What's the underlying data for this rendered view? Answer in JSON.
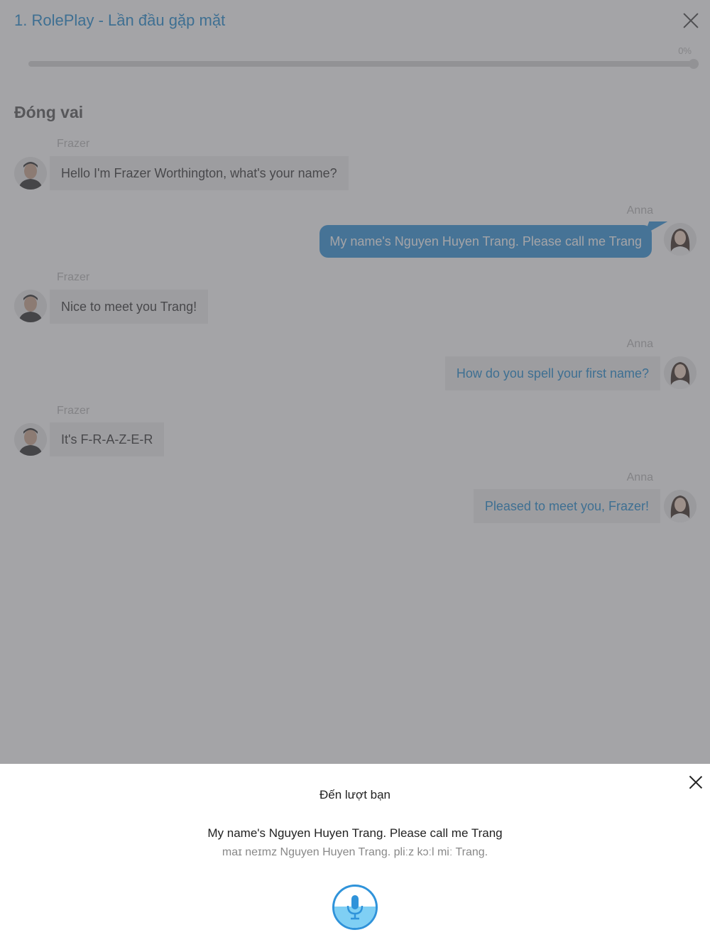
{
  "header": {
    "title": "1. RolePlay - Lần đầu gặp mặt",
    "close_icon": "close-icon",
    "progress_label": "0%",
    "progress_fraction": 0
  },
  "section_title": "Đóng vai",
  "messages": [
    {
      "speaker": "Frazer",
      "text": "Hello I'm Frazer Worthington, what's your name?",
      "side": "left"
    },
    {
      "speaker": "Anna",
      "text": "My name's Nguyen Huyen Trang. Please call me Trang",
      "side": "right",
      "active": true
    },
    {
      "speaker": "Frazer",
      "text": "Nice to meet you Trang!",
      "side": "left"
    },
    {
      "speaker": "Anna",
      "text": "How do you spell your first name?",
      "side": "right"
    },
    {
      "speaker": "Frazer",
      "text": "It's F-R-A-Z-E-R",
      "side": "left"
    },
    {
      "speaker": "Anna",
      "text": "Pleased to meet you, Frazer!",
      "side": "right"
    }
  ],
  "sheet": {
    "heading": "Đến lượt bạn",
    "sentence": "My name's Nguyen Huyen Trang. Please call me Trang",
    "ipa": "maɪ neɪmz Nguyen Huyen Trang. pliːz kɔːl miː Trang.",
    "close_icon": "close-icon",
    "mic_icon": "microphone-icon",
    "mic_level": 0.52
  },
  "colors": {
    "accent": "#2f93da",
    "title": "#1e8bd0",
    "overlay": "#5a5a5e",
    "mic_fill": "#7fcff4"
  }
}
